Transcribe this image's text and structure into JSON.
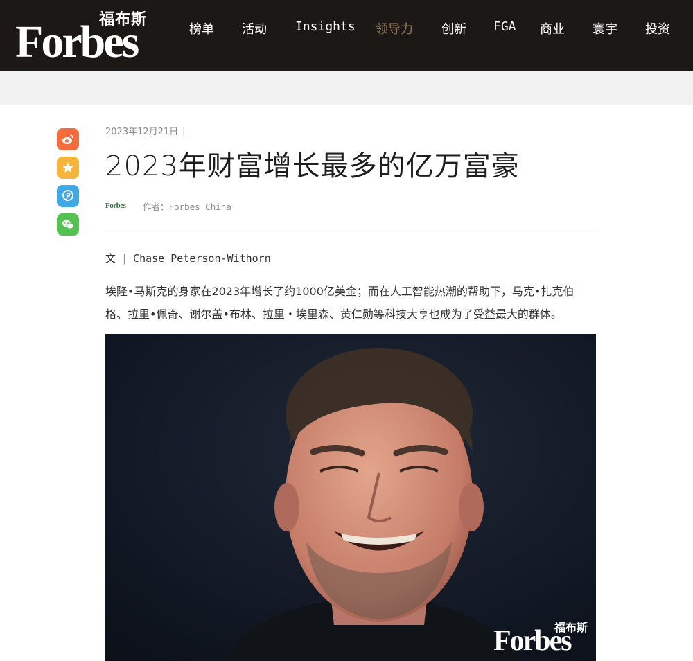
{
  "header": {
    "logo_cn": "福布斯",
    "logo_en": "Forbes",
    "nav": [
      {
        "label": "榜单"
      },
      {
        "label": "活动"
      },
      {
        "label": "Insights"
      },
      {
        "label": "领导力",
        "active": true
      },
      {
        "label": "创新"
      },
      {
        "label": "FGA"
      },
      {
        "label": "商业"
      },
      {
        "label": "寰宇"
      },
      {
        "label": "投资"
      }
    ]
  },
  "share": {
    "items": [
      "weibo-icon",
      "star-icon",
      "pinterest-icon",
      "wechat-icon"
    ],
    "colors": {
      "weibo": "#f26c3e",
      "favorite": "#f6b53a",
      "pin": "#41a8e6",
      "wechat": "#54c153"
    }
  },
  "article": {
    "date": "2023年12月21日",
    "separator": "|",
    "title": "2023年财富增长最多的亿万富豪",
    "author_logo": "Forbes",
    "author_label": "作者：Forbes China",
    "byline_prefix": "文",
    "byline_sep": "|",
    "byline_name": "Chase Peterson-Withorn",
    "summary": "埃隆•马斯克的身家在2023年增长了约1000亿美金；而在人工智能热潮的帮助下，马克•扎克伯格、拉里•佩奇、谢尔盖•布林、拉里・埃里森、黄仁勋等科技大亨也成为了受益最大的群体。"
  },
  "hero": {
    "watermark_cn": "福布斯",
    "watermark_en": "Forbes"
  },
  "colors": {
    "header_bg": "#1b1816",
    "accent_nav": "#8d7656",
    "band": "#f2f2f2"
  }
}
